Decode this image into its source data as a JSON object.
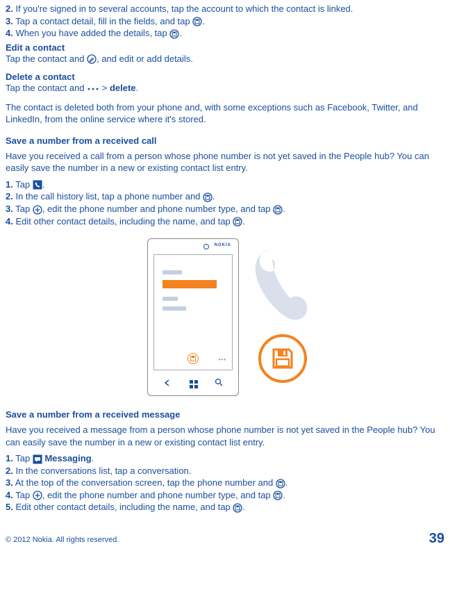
{
  "intro_steps": {
    "s2": {
      "num": "2.",
      "text": "If you're signed in to several accounts, tap the account to which the contact is linked."
    },
    "s3": {
      "num": "3.",
      "text_a": "Tap a contact detail, fill in the fields, and tap ",
      "text_b": "."
    },
    "s4": {
      "num": "4.",
      "text_a": "When you have added the details, tap ",
      "text_b": "."
    }
  },
  "edit": {
    "heading": "Edit a contact",
    "text_a": "Tap the contact and ",
    "text_b": ", and edit or add details."
  },
  "delete": {
    "heading": "Delete a contact",
    "text_a": "Tap the contact and  ",
    "gt": ">",
    "delete_word": "delete",
    "text_b": "."
  },
  "delete_note": "The contact is deleted both from your phone and, with some exceptions such as Facebook, Twitter, and LinkedIn, from the online service where it's stored.",
  "save_call": {
    "heading": "Save a number from a received call",
    "intro": "Have you received a call from a person whose phone number is not yet saved in the People hub? You can easily save the number in a new or existing contact list entry.",
    "s1": {
      "num": "1.",
      "text_a": "Tap ",
      "text_b": "."
    },
    "s2": {
      "num": "2.",
      "text_a": "In the call history list, tap a phone number and ",
      "text_b": "."
    },
    "s3": {
      "num": "3.",
      "text_a": "Tap ",
      "text_b": ", edit the phone number and phone number type, and tap ",
      "text_c": "."
    },
    "s4": {
      "num": "4.",
      "text_a": "Edit other contact details, including the name, and tap ",
      "text_b": "."
    }
  },
  "save_msg": {
    "heading": "Save a number from a received message",
    "intro": "Have you received a message from a person whose phone number is not yet saved in the People hub? You can easily save the number in a new or existing contact list entry.",
    "s1": {
      "num": "1.",
      "text_a": "Tap ",
      "label": "Messaging",
      "text_b": "."
    },
    "s2": {
      "num": "2.",
      "text": "In the conversations list, tap a conversation."
    },
    "s3": {
      "num": "3.",
      "text_a": "At the top of the conversation screen, tap the phone number and ",
      "text_b": "."
    },
    "s4": {
      "num": "4.",
      "text_a": "Tap ",
      "text_b": ", edit the phone number and phone number type, and tap ",
      "text_c": "."
    },
    "s5": {
      "num": "5.",
      "text_a": "Edit other contact details, including the name, and tap ",
      "text_b": "."
    }
  },
  "phone_brand": "NOKIA",
  "footer": {
    "copyright": "© 2012 Nokia. All rights reserved.",
    "page": "39"
  }
}
